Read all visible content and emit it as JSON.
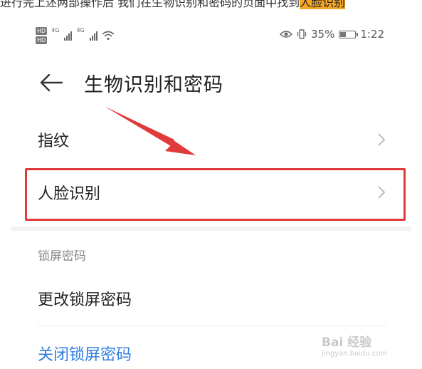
{
  "caption": {
    "prefix": "进行完上述两部操作后 我们在生物识别和密码的页面中找到",
    "highlight": "人脸识别"
  },
  "status_bar": {
    "hd": "HD",
    "net1": "4G",
    "net2": "4G",
    "battery_percent": "35%",
    "battery_level": 0.35,
    "time": "1:22"
  },
  "header": {
    "title": "生物识别和密码"
  },
  "list": {
    "fingerprint": "指纹",
    "face_recognition": "人脸识别",
    "lock_section": "锁屏密码",
    "change_lock": "更改锁屏密码",
    "close_lock": "关闭锁屏密码"
  },
  "colors": {
    "annotation_red": "#e03a3a",
    "link_blue": "#2f7fe0",
    "caption_highlight": "#f5a623"
  },
  "watermark": {
    "brand": "Bai 经验",
    "url": "jingyan.baidu.com"
  }
}
